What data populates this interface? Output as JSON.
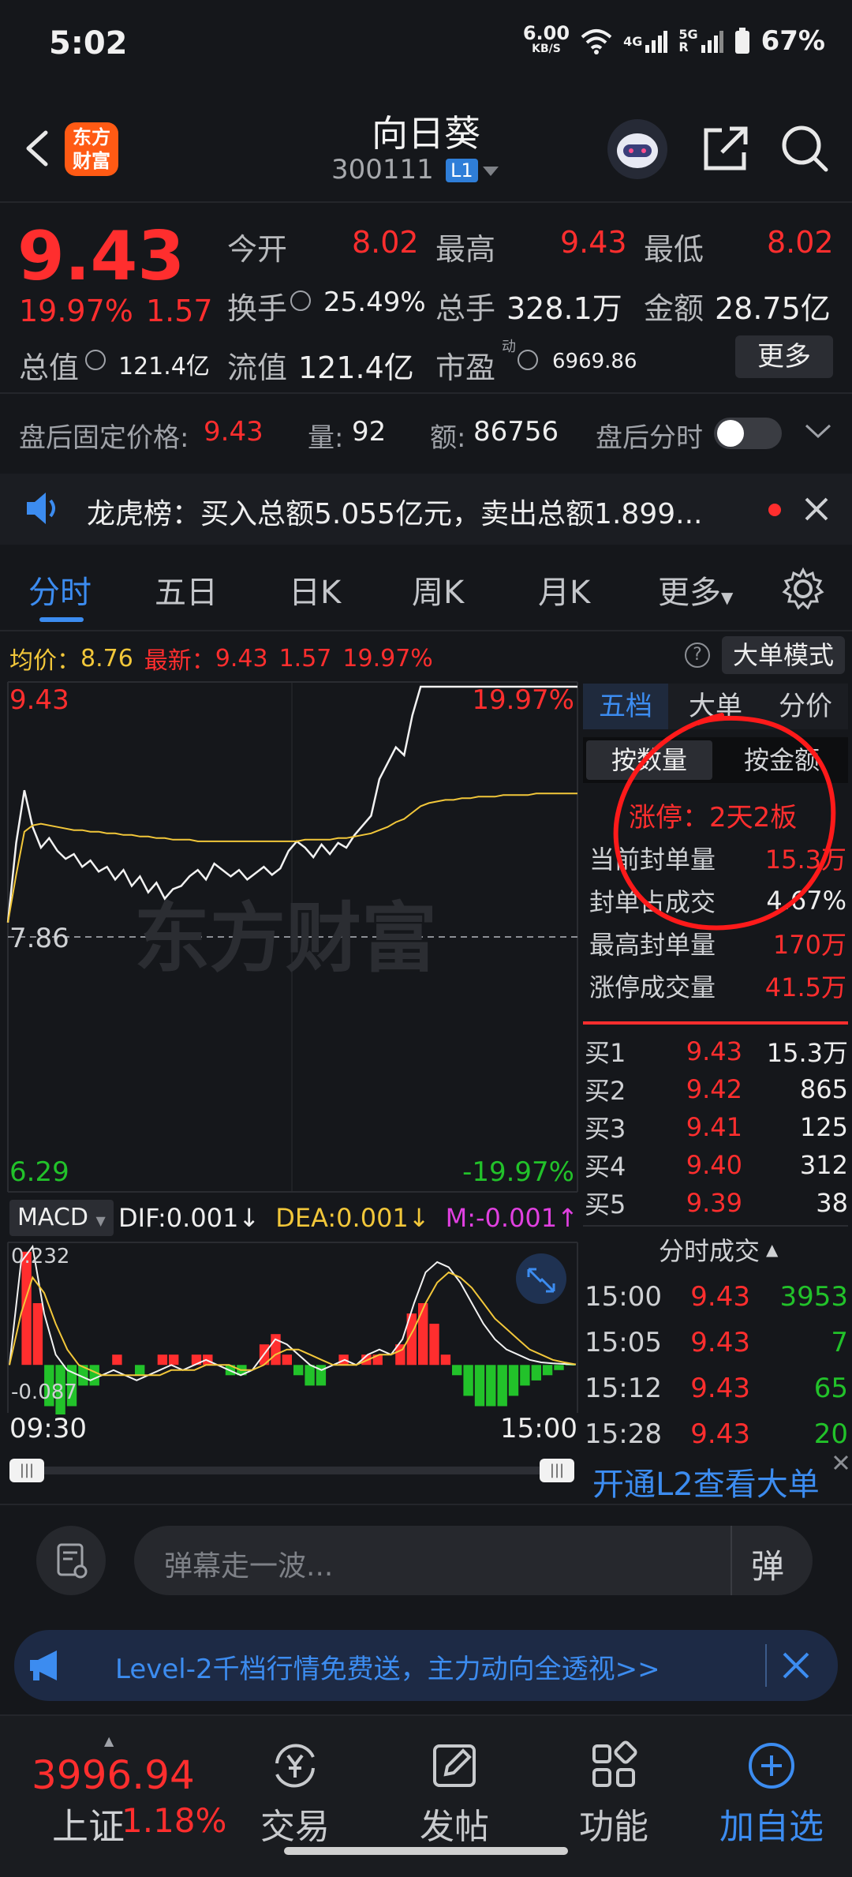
{
  "status_bar": {
    "time": "5:02",
    "net_speed": "6.00",
    "net_unit": "KB/S",
    "sig1": "4G",
    "sig2": "5G",
    "sig2_sub": "R",
    "battery": "67%"
  },
  "header": {
    "logo_text_1": "东方",
    "logo_text_2": "财富",
    "stock_name": "向日葵",
    "stock_code": "300111",
    "level_badge": "L1"
  },
  "quote": {
    "price": "9.43",
    "change_pct": "19.97%",
    "change": "1.57",
    "open_label": "今开",
    "open": "8.02",
    "high_label": "最高",
    "high": "9.43",
    "low_label": "最低",
    "low": "8.02",
    "turnover_label": "换手",
    "turnover": "25.49%",
    "volume_label": "总手",
    "volume": "328.1万",
    "amount_label": "金额",
    "amount": "28.75亿",
    "mcap_label": "总值",
    "mcap": "121.4亿",
    "float_label": "流值",
    "float": "121.4亿",
    "pe_label": "市盈",
    "pe_sup": "动",
    "pe": "6969.86",
    "more_label": "更多"
  },
  "after_hours": {
    "price_label": "盘后固定价格:",
    "price": "9.43",
    "vol_label": "量:",
    "vol": "92",
    "amt_label": "额:",
    "amt": "86756",
    "timeshare_label": "盘后分时"
  },
  "ticker": {
    "text": "龙虎榜：买入总额5.055亿元，卖出总额1.899..."
  },
  "tabs": [
    "分时",
    "五日",
    "日K",
    "周K",
    "月K",
    "更多"
  ],
  "chart_header": {
    "avg_label": "均价：",
    "avg": "8.76",
    "latest_label": "最新：",
    "latest": "9.43",
    "chg": "1.57",
    "pct": "19.97%",
    "big_order_btn": "大单模式"
  },
  "chart_data": {
    "type": "line",
    "title": "",
    "ylim": [
      6.29,
      9.43
    ],
    "y_top_label": "9.43",
    "y_mid_label": "7.86",
    "y_bottom_label": "6.29",
    "pct_top_label": "19.97%",
    "pct_bottom_label": "-19.97%",
    "x_start_label": "09:30",
    "x_end_label": "15:00",
    "series": [
      {
        "values": [
          7.95,
          8.45,
          8.78,
          8.55,
          8.42,
          8.48,
          8.4,
          8.35,
          8.38,
          8.3,
          8.34,
          8.27,
          8.3,
          8.22,
          8.28,
          8.18,
          8.24,
          8.14,
          8.2,
          8.1,
          8.16,
          8.18,
          8.24,
          8.28,
          8.22,
          8.32,
          8.28,
          8.24,
          8.28,
          8.22,
          8.26,
          8.3,
          8.25,
          8.29,
          8.4,
          8.46,
          8.42,
          8.36,
          8.44,
          8.38,
          8.45,
          8.42,
          8.5,
          8.56,
          8.62,
          8.85,
          8.95,
          9.05,
          9.0,
          9.25,
          9.43,
          9.43,
          9.43,
          9.43,
          9.43,
          9.43,
          9.43,
          9.43,
          9.43,
          9.43,
          9.43,
          9.43,
          9.43,
          9.43,
          9.43,
          9.43,
          9.43,
          9.43,
          9.43,
          9.43
        ]
      },
      {
        "values": [
          7.95,
          8.25,
          8.52,
          8.56,
          8.57,
          8.56,
          8.55,
          8.54,
          8.53,
          8.53,
          8.52,
          8.52,
          8.51,
          8.51,
          8.5,
          8.5,
          8.49,
          8.49,
          8.48,
          8.48,
          8.47,
          8.47,
          8.47,
          8.46,
          8.46,
          8.46,
          8.46,
          8.46,
          8.46,
          8.46,
          8.46,
          8.46,
          8.46,
          8.46,
          8.46,
          8.46,
          8.47,
          8.47,
          8.47,
          8.47,
          8.48,
          8.48,
          8.49,
          8.5,
          8.51,
          8.53,
          8.55,
          8.58,
          8.6,
          8.64,
          8.68,
          8.7,
          8.71,
          8.72,
          8.72,
          8.73,
          8.73,
          8.74,
          8.74,
          8.74,
          8.75,
          8.75,
          8.75,
          8.75,
          8.76,
          8.76,
          8.76,
          8.76,
          8.76,
          8.76
        ]
      }
    ]
  },
  "macd": {
    "selector": "MACD",
    "dif_label": "DIF:",
    "dif": "0.001",
    "dea_label": "DEA:",
    "dea": "0.001",
    "m_label": "M:",
    "m": "-0.001",
    "top_label": "0.232",
    "bottom_label": "-0.087",
    "ylim": [
      -0.087,
      0.232
    ],
    "dif_values": [
      0.0,
      0.2,
      0.23,
      0.1,
      0.02,
      -0.01,
      -0.02,
      -0.03,
      -0.02,
      -0.01,
      -0.02,
      -0.03,
      -0.02,
      -0.01,
      0.0,
      -0.01,
      0.0,
      0.01,
      0.0,
      -0.01,
      -0.02,
      -0.01,
      0.02,
      0.05,
      0.04,
      0.02,
      0.0,
      -0.01,
      0.0,
      0.01,
      0.0,
      0.02,
      0.03,
      0.02,
      0.05,
      0.12,
      0.18,
      0.2,
      0.19,
      0.16,
      0.12,
      0.08,
      0.05,
      0.03,
      0.02,
      0.01,
      0.005,
      0.003,
      0.002,
      0.001
    ],
    "dea_values": [
      0.0,
      0.1,
      0.17,
      0.14,
      0.08,
      0.03,
      0.0,
      -0.01,
      -0.02,
      -0.02,
      -0.02,
      -0.02,
      -0.02,
      -0.02,
      -0.01,
      -0.01,
      -0.01,
      0.0,
      0.0,
      0.0,
      -0.01,
      -0.01,
      0.0,
      0.02,
      0.03,
      0.03,
      0.02,
      0.01,
      0.0,
      0.0,
      0.0,
      0.01,
      0.02,
      0.02,
      0.03,
      0.07,
      0.12,
      0.16,
      0.18,
      0.17,
      0.15,
      0.12,
      0.09,
      0.07,
      0.05,
      0.03,
      0.02,
      0.01,
      0.005,
      0.001
    ],
    "hist_values": [
      0.0,
      0.22,
      0.12,
      -0.08,
      -0.12,
      -0.08,
      -0.04,
      -0.04,
      0.0,
      0.02,
      0.0,
      -0.02,
      0.0,
      0.02,
      0.02,
      0.0,
      0.02,
      0.02,
      0.0,
      -0.02,
      -0.02,
      0.0,
      0.04,
      0.06,
      0.02,
      -0.02,
      -0.04,
      -0.04,
      0.0,
      0.02,
      0.0,
      0.02,
      0.02,
      0.0,
      0.04,
      0.1,
      0.12,
      0.08,
      0.02,
      -0.02,
      -0.06,
      -0.08,
      -0.08,
      -0.08,
      -0.06,
      -0.04,
      -0.03,
      -0.02,
      -0.01,
      -0.001
    ]
  },
  "order_panel": {
    "tabs": [
      "五档",
      "大单",
      "分价"
    ],
    "mode_tabs": [
      "按数量",
      "按金额"
    ],
    "limit_up": "涨停：2天2板",
    "stats": [
      {
        "label": "当前封单量",
        "value": "15.3万"
      },
      {
        "label": "封单占成交",
        "value": "4.67%"
      },
      {
        "label": "最高封单量",
        "value": "170万"
      },
      {
        "label": "涨停成交量",
        "value": "41.5万"
      }
    ],
    "bids": [
      {
        "label": "买1",
        "price": "9.43",
        "vol": "15.3万"
      },
      {
        "label": "买2",
        "price": "9.42",
        "vol": "865"
      },
      {
        "label": "买3",
        "price": "9.41",
        "vol": "125"
      },
      {
        "label": "买4",
        "price": "9.40",
        "vol": "312"
      },
      {
        "label": "买5",
        "price": "9.39",
        "vol": "38"
      }
    ],
    "trades_title": "分时成交",
    "trades": [
      {
        "time": "15:00",
        "price": "9.43",
        "vol": "3953"
      },
      {
        "time": "15:05",
        "price": "9.43",
        "vol": "7"
      },
      {
        "time": "15:12",
        "price": "9.43",
        "vol": "65"
      },
      {
        "time": "15:28",
        "price": "9.43",
        "vol": "20"
      }
    ],
    "l2_link": "开通L2查看大单"
  },
  "watermark": "东方财富",
  "danmu": {
    "placeholder": "弹幕走一波...",
    "send_label": "弹"
  },
  "promo": {
    "text": "Level-2千档行情免费送，主力动向全透视>>"
  },
  "bottom_nav": {
    "index_value": "3996.94",
    "index_name": "上证",
    "index_pct": "1.18%",
    "trade": "交易",
    "post": "发帖",
    "features": "功能",
    "add_watch": "加自选"
  },
  "colors": {
    "up": "#ff2e2e",
    "down": "#22c22a",
    "accent": "#3c8cf0",
    "avg_line": "#f2c73a",
    "bg": "#15171b"
  }
}
